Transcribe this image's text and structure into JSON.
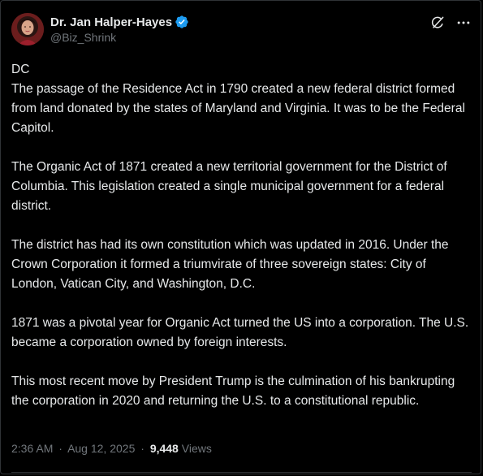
{
  "author": {
    "display_name": "Dr. Jan Halper-Hayes",
    "handle": "@Biz_Shrink",
    "verified": true,
    "avatar_icon": "profile-photo",
    "verified_icon": "verified-badge-icon",
    "verified_color": "#1d9bf0"
  },
  "actions": {
    "grok_icon": "grok-icon",
    "more_icon": "more-options-icon"
  },
  "post": {
    "title_line": "DC",
    "paragraph_1": "The passage of the Residence Act in 1790 created a new federal district formed from land donated by the states of Maryland and Virginia. It was to be the Federal Capitol.",
    "paragraph_2": "The Organic Act of 1871 created a new territorial government for the District of Columbia. This legislation created a single municipal government for a federal district.",
    "paragraph_3": "The district has had its own constitution which was updated in 2016. Under the Crown Corporation it formed a triumvirate of three sovereign states: City of London, Vatican City, and Washington, D.C.",
    "paragraph_4": "1871 was a pivotal year for Organic Act turned the US into a corporation. The U.S. became a corporation owned by foreign interests.",
    "paragraph_5": "This most recent move by President Trump is the culmination of his bankrupting the corporation in 2020 and returning the U.S. to a constitutional republic."
  },
  "meta": {
    "time": "2:36 AM",
    "separator_1": "·",
    "date": "Aug 12, 2025",
    "separator_2": "·",
    "views_count": "9,448",
    "views_label": "Views"
  },
  "colors": {
    "background": "#000000",
    "text_primary": "#e7e9ea",
    "text_secondary": "#71767b",
    "border": "#2f3336"
  }
}
